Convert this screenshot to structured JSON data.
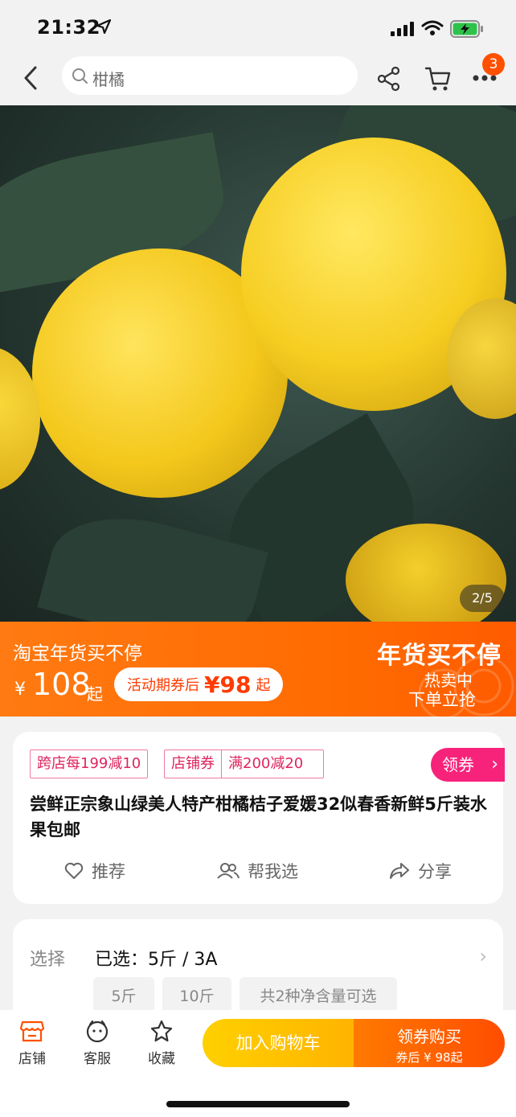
{
  "status": {
    "time": "21:32"
  },
  "nav": {
    "search_text": "柑橘",
    "badge": "3"
  },
  "gallery": {
    "pager": "2/5"
  },
  "promo": {
    "title": "淘宝年货买不停",
    "yen": "¥",
    "price": "108",
    "qi": "起",
    "coupon_label": "活动期券后",
    "coupon_value": "¥98",
    "coupon_qi": "起",
    "right_title": "年货买不停",
    "right_sub1": "热卖中",
    "right_sub2": "下单立抢"
  },
  "product": {
    "tag_cross": "跨店每199减10",
    "tag_shop": "店铺券",
    "tag_full": "满200减20",
    "coupon_btn": "领券",
    "title": "尝鲜正宗象山绿美人特产柑橘桔子爱媛32似春香新鲜5斤装水果包邮",
    "actions": {
      "recommend": "推荐",
      "help": "帮我选",
      "share": "分享"
    }
  },
  "select": {
    "label": "选择",
    "value": "已选：5斤 / 3A",
    "options": [
      "5斤",
      "10斤",
      "共2种净含量可选"
    ]
  },
  "bottom": {
    "shop": "店铺",
    "service": "客服",
    "fav": "收藏",
    "add_cart": "加入购物车",
    "buy": "领券购买",
    "buy_sub": "券后 ¥ 98起"
  },
  "colors": {
    "accent": "#ff5000",
    "promo_bg": "#ff6a00",
    "tag": "#e0245e"
  }
}
